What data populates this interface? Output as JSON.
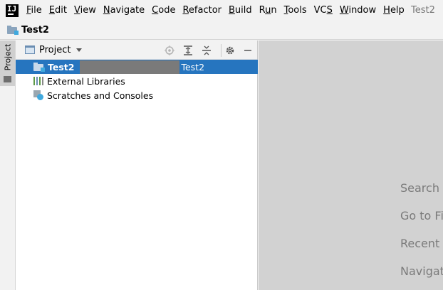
{
  "menubar": {
    "logo_text": "IJ",
    "items": [
      {
        "pre": "",
        "mn": "F",
        "post": "ile"
      },
      {
        "pre": "",
        "mn": "E",
        "post": "dit"
      },
      {
        "pre": "",
        "mn": "V",
        "post": "iew"
      },
      {
        "pre": "",
        "mn": "N",
        "post": "avigate"
      },
      {
        "pre": "",
        "mn": "C",
        "post": "ode"
      },
      {
        "pre": "",
        "mn": "R",
        "post": "efactor"
      },
      {
        "pre": "",
        "mn": "B",
        "post": "uild"
      },
      {
        "pre": "R",
        "mn": "u",
        "post": "n"
      },
      {
        "pre": "",
        "mn": "T",
        "post": "ools"
      },
      {
        "pre": "VC",
        "mn": "S",
        "post": ""
      },
      {
        "pre": "",
        "mn": "W",
        "post": "indow"
      },
      {
        "pre": "",
        "mn": "H",
        "post": "elp"
      }
    ],
    "window_title": "Test2"
  },
  "navbar": {
    "project_name": "Test2"
  },
  "left_stripe": {
    "tab_label": "Project"
  },
  "project_panel": {
    "title": "Project",
    "tree": {
      "root_label": "Test2",
      "root_path_label": "Test2",
      "external_libraries": "External Libraries",
      "scratches": "Scratches and Consoles"
    }
  },
  "editor": {
    "hints": [
      "Search E",
      "Go to Fi",
      "Recent F",
      "Navigat"
    ]
  },
  "colors": {
    "selection": "#2675bf",
    "editor_bg": "#d2d2d2",
    "accent": "#40a9de"
  }
}
